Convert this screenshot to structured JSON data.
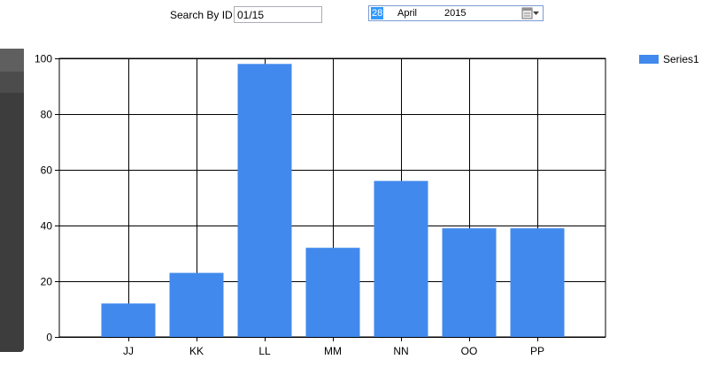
{
  "search": {
    "label": "Search By ID",
    "value": "01/15"
  },
  "date_picker": {
    "day": "28",
    "month": "April",
    "year": "2015",
    "calendar_icon": "calendar-icon"
  },
  "colors": {
    "bar": "#4189ed",
    "grid": "#000000"
  },
  "chart_data": {
    "type": "bar",
    "categories": [
      "JJ",
      "KK",
      "LL",
      "MM",
      "NN",
      "OO",
      "PP"
    ],
    "series": [
      {
        "name": "Series1",
        "values": [
          12,
          23,
          98,
          32,
          56,
          39,
          39
        ]
      }
    ],
    "yticks": [
      "0",
      "20",
      "40",
      "60",
      "80",
      "100"
    ],
    "ylim": [
      0,
      100
    ],
    "grid": true,
    "legend_position": "top-right"
  }
}
